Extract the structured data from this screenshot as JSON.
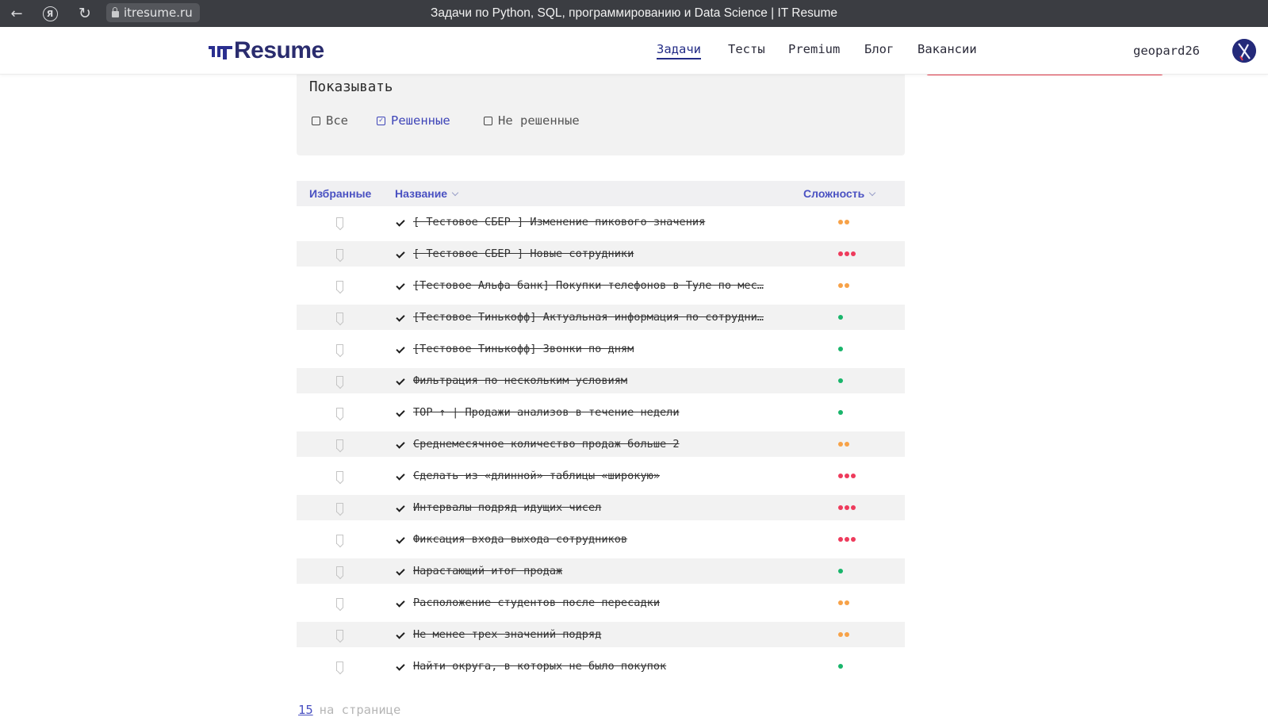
{
  "browser": {
    "url": "itresume.ru",
    "page_title": "Задачи по Python, SQL, программированию и Data Science | IT Resume"
  },
  "header": {
    "logo_text": "Resume",
    "nav": [
      "Задачи",
      "Тесты",
      "Premium",
      "Блог",
      "Вакансии"
    ],
    "active_nav": "Задачи",
    "username": "geopard26"
  },
  "filter": {
    "title": "Показывать",
    "options": [
      {
        "label": "Все",
        "checked": false
      },
      {
        "label": "Решенные",
        "checked": true
      },
      {
        "label": "Не решенные",
        "checked": false
      }
    ]
  },
  "table": {
    "columns": {
      "favorites": "Избранные",
      "name": "Название",
      "difficulty": "Сложность"
    },
    "rows": [
      {
        "name": "[ Тестовое СБЕР ] Изменение пикового значения",
        "difficulty": 2
      },
      {
        "name": "[ Тестовое СБЕР ] Новые сотрудники",
        "difficulty": 3
      },
      {
        "name": "[Тестовое Альфа банк] Покупки телефонов в Туле по мес…",
        "difficulty": 2
      },
      {
        "name": "[Тестовое Тинькофф] Актуальная информация по сотрудни…",
        "difficulty": 1
      },
      {
        "name": "[Тестовое Тинькофф] Звонки по дням",
        "difficulty": 1
      },
      {
        "name": "Фильтрация по нескольким условиям",
        "difficulty": 1
      },
      {
        "name": "TOP ↑ | Продажи анализов в течение недели",
        "difficulty": 1
      },
      {
        "name": "Среднемесячное количество продаж больше 2",
        "difficulty": 2
      },
      {
        "name": "Сделать из «длинной» таблицы «широкую»",
        "difficulty": 3
      },
      {
        "name": "Интервалы подряд идущих чисел",
        "difficulty": 3
      },
      {
        "name": "Фиксация входа выхода сотрудников",
        "difficulty": 3
      },
      {
        "name": "Нарастающий итог продаж",
        "difficulty": 1
      },
      {
        "name": "Расположение студентов после пересадки",
        "difficulty": 2
      },
      {
        "name": "Не менее трех значений подряд",
        "difficulty": 2
      },
      {
        "name": "Найти округа, в которых не было покупок",
        "difficulty": 1
      }
    ]
  },
  "difficulty_colors": {
    "1": "#19b56b",
    "2": "#f7a248",
    "3": "#ee3b5c"
  },
  "pager": {
    "per_page": "15",
    "suffix": "на странице"
  }
}
